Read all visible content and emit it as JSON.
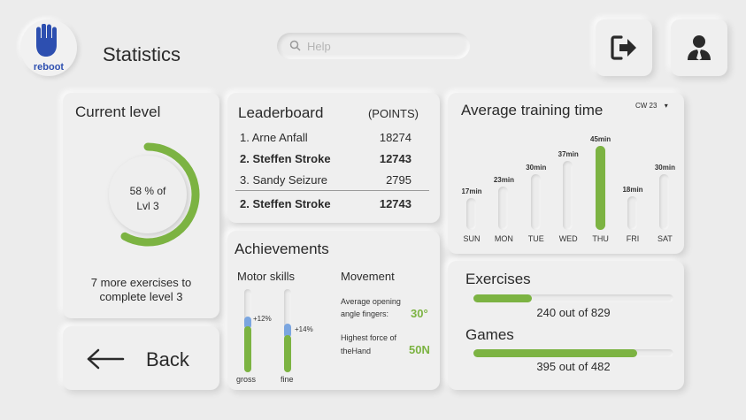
{
  "app": {
    "logo_text": "reboot",
    "title": "Statistics"
  },
  "search": {
    "placeholder": "Help"
  },
  "header_buttons": {
    "logout_icon": "logout-icon",
    "profile_icon": "user-icon"
  },
  "colors": {
    "accent_green": "#7cb342",
    "accent_blue": "#7ba6e0",
    "brand_blue": "#2d4fb0",
    "bar_gray": "#e3e3e3"
  },
  "current_level": {
    "title": "Current level",
    "percent_label": "58 % of",
    "level_label": "Lvl 3",
    "progress": 0.58,
    "remaining_line1": "7 more exercises to",
    "remaining_line2": "complete level 3"
  },
  "leaderboard": {
    "title": "Leaderboard",
    "points_header": "(POINTS)",
    "rows": [
      {
        "name": "1. Arne Anfall",
        "points": "18274",
        "bold": false
      },
      {
        "name": "2. Steffen Stroke",
        "points": "12743",
        "bold": true
      },
      {
        "name": "3. Sandy Seizure",
        "points": "2795",
        "bold": false
      }
    ],
    "current_user": {
      "name": "2. Steffen Stroke",
      "points": "12743"
    }
  },
  "training": {
    "title": "Average training time",
    "week_label": "CW 23",
    "days": [
      {
        "day": "SUN",
        "value": "17min",
        "minutes": 17,
        "highlight": false
      },
      {
        "day": "MON",
        "value": "23min",
        "minutes": 23,
        "highlight": false
      },
      {
        "day": "TUE",
        "value": "30min",
        "minutes": 30,
        "highlight": false
      },
      {
        "day": "WED",
        "value": "37min",
        "minutes": 37,
        "highlight": false
      },
      {
        "day": "THU",
        "value": "45min",
        "minutes": 45,
        "highlight": true
      },
      {
        "day": "FRI",
        "value": "18min",
        "minutes": 18,
        "highlight": false
      },
      {
        "day": "SAT",
        "value": "30min",
        "minutes": 30,
        "highlight": false
      }
    ]
  },
  "achievements": {
    "title": "Achievements",
    "motor_title": "Motor skills",
    "gross": {
      "label": "gross",
      "delta": "+12%",
      "base": 0.55,
      "gain": 0.12
    },
    "fine": {
      "label": "fine",
      "delta": "+14%",
      "base": 0.45,
      "gain": 0.14
    },
    "movement_title": "Movement",
    "opening_line1": "Average opening",
    "opening_line2": "angle fingers:",
    "opening_value": "30°",
    "force_line1": "Highest force of",
    "force_line2": "theHand",
    "force_value": "50N"
  },
  "progress": {
    "exercises_title": "Exercises",
    "exercises_text": "240 out of 829",
    "exercises_fraction": 0.29,
    "games_title": "Games",
    "games_text": "395 out of 482",
    "games_fraction": 0.82
  },
  "back": {
    "label": "Back"
  }
}
